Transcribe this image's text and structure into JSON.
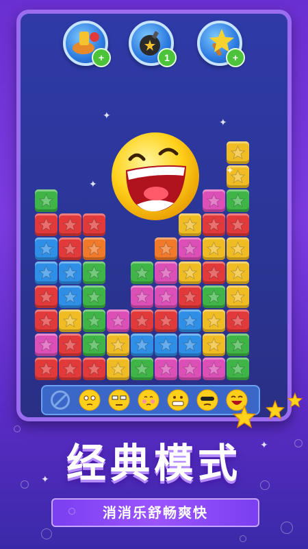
{
  "game": {
    "boosters": [
      {
        "name": "paint-brush-booster",
        "badge": "+",
        "accent": "#f6c230"
      },
      {
        "name": "bomb-booster",
        "badge": "1",
        "accent": "#2b2b2b"
      },
      {
        "name": "star-wand-booster",
        "badge": "+",
        "accent": "#f6d230"
      }
    ],
    "tile_colors": {
      "R": "#e23a3a",
      "Y": "#f0bc24",
      "G": "#3fb447",
      "B": "#2f8fe6",
      "P": "#dc4fb6",
      "O": "#f07a2a"
    },
    "grid_rows": [
      "......Y",
      "......Y",
      "G......PG",
      "RRR...YRR",
      "BRO..OPYY",
      "BBG.GPYRY",
      "RBG.PPRGY",
      "RYGPRRBYR",
      "PRGYBBBYG",
      "RRRYGPPPG"
    ],
    "emoji_bar": [
      "forbidden-icon",
      "dizzy-emoji",
      "sleepy-emoji",
      "blushing-emoji",
      "grimacing-emoji",
      "cool-emoji",
      "laughing-emoji"
    ],
    "title": "经典模式",
    "subtitle": "消消乐舒畅爽快"
  }
}
